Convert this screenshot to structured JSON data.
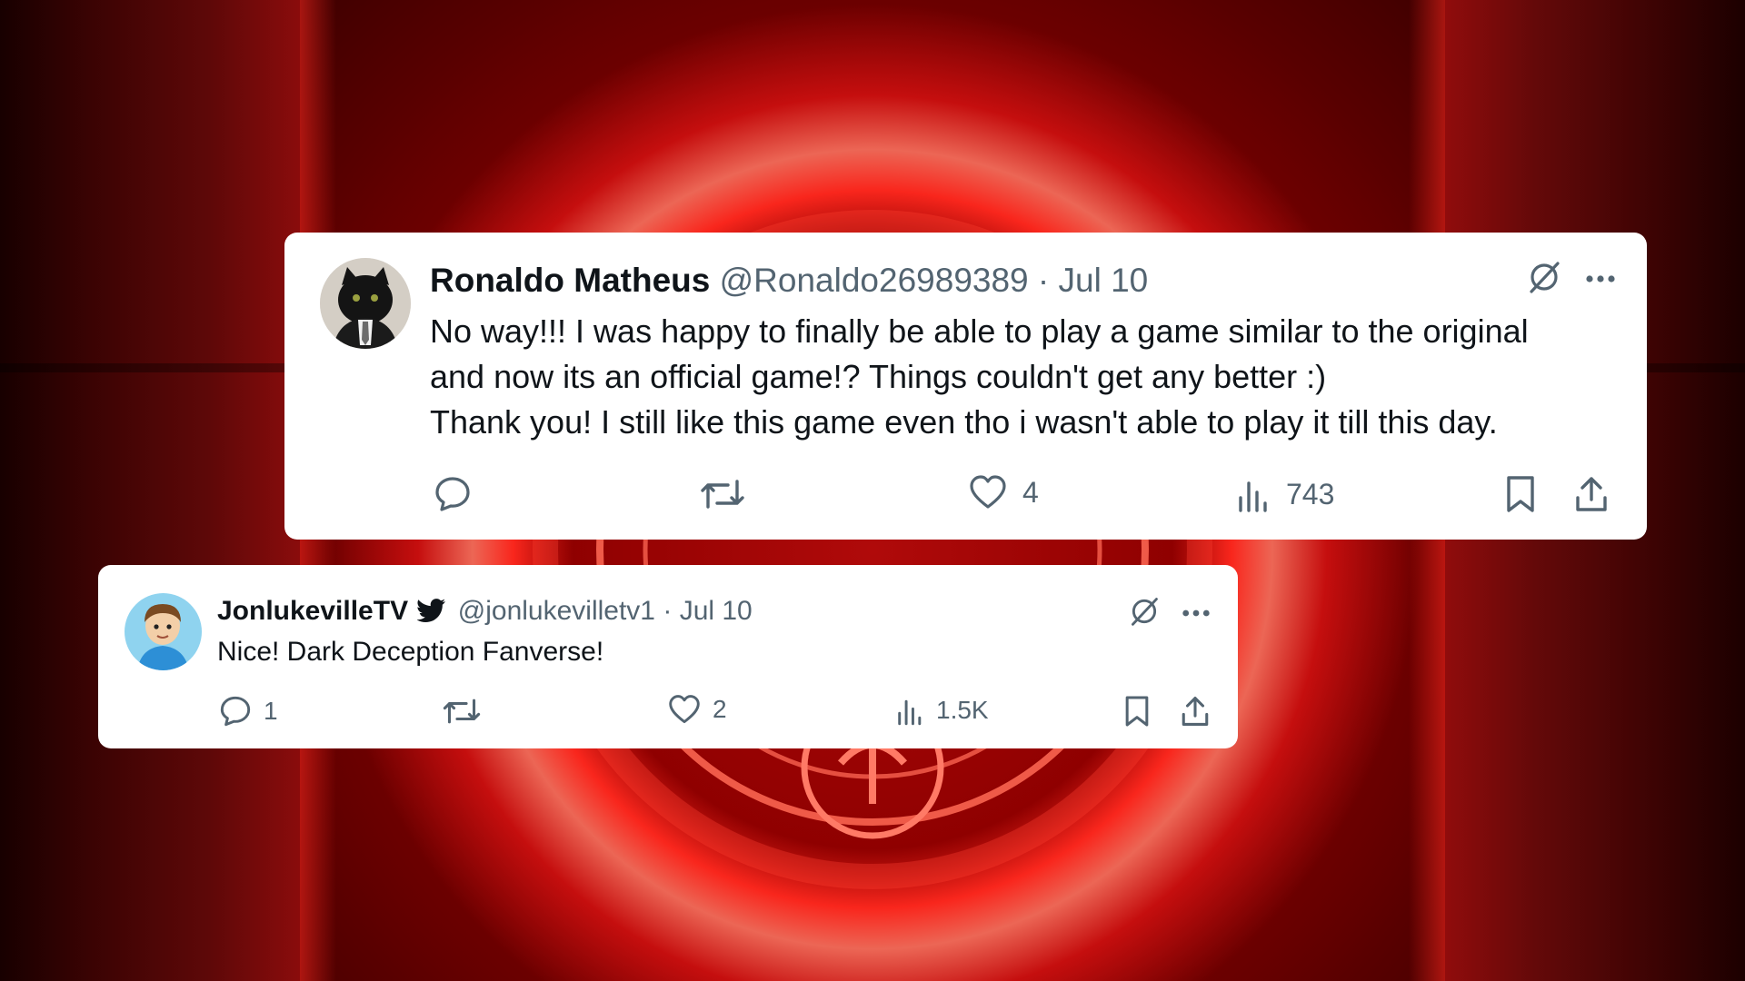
{
  "tweets": [
    {
      "name": "Ronaldo Matheus",
      "handle": "@Ronaldo26989389",
      "separator": "·",
      "date": "Jul 10",
      "verified": false,
      "text_lines": [
        "No way!!! I was happy to finally be able to play a game similar to the original",
        "and now its an official game!? Things couldn't get any better :)",
        "Thank you! I still like this game even tho i wasn't able to play it till this day."
      ],
      "stats": {
        "replies": "",
        "retweets": "",
        "likes": "4",
        "views": "743"
      },
      "avatar": "black-cat-in-suit"
    },
    {
      "name": "JonlukevilleTV",
      "handle": "@jonlukevilletv1",
      "separator": "·",
      "date": "Jul 10",
      "verified": true,
      "text_lines": [
        "Nice! Dark Deception Fanverse!"
      ],
      "stats": {
        "replies": "1",
        "retweets": "",
        "likes": "2",
        "views": "1.5K"
      },
      "avatar": "cartoon-boy"
    }
  ],
  "icons": {
    "reply": "reply-icon",
    "retweet": "retweet-icon",
    "like": "heart-icon",
    "views": "views-icon",
    "bookmark": "bookmark-icon",
    "share": "share-icon",
    "grok": "grok-icon",
    "more": "more-icon",
    "bird": "twitter-bird-icon"
  },
  "colors": {
    "card": "#ffffff",
    "text": "#0f1419",
    "muted": "#536471",
    "background": "#8e0000",
    "glow": "#ff3020"
  }
}
